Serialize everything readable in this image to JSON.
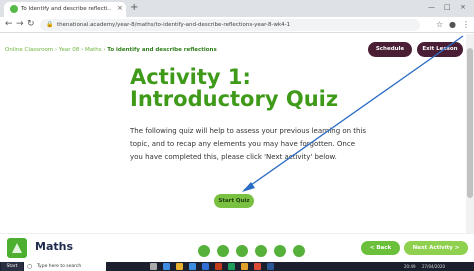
{
  "browser": {
    "tab_title": "To Identify and describe reflecti...",
    "tab_close": "×",
    "new_tab": "+",
    "window_controls": [
      "—",
      "□",
      "×"
    ],
    "url": "thenational.academy/year-8/maths/to-identify-and-describe-reflections-year-8-wk4-1",
    "nav_icons": [
      "back-icon",
      "forward-icon",
      "reload-icon"
    ],
    "toolbar_icons": [
      "star-icon",
      "profile-icon",
      "menu-icon"
    ]
  },
  "page": {
    "breadcrumb": {
      "prefix": "Online Classroom › Year 08 › Maths › ",
      "current": "To identify and describe reflections"
    },
    "schedule_label": "Schedule",
    "exit_label": "Exit Lesson",
    "activity_title": "Activity 1: Introductory Quiz",
    "intro_text": "The following quiz will help to assess your previous learning on this topic, and to recap any elements you may have forgotten. Once you have completed this, please click 'Next activity' below.",
    "start_label": "Start Quiz"
  },
  "footer": {
    "subject": "Maths",
    "progress_total": 6,
    "back_label": "< Back",
    "next_label": "Next Activity >"
  },
  "taskbar": {
    "start_label": "Start",
    "search_placeholder": "Type here to search",
    "tray_time": "20:49",
    "tray_date": "27/04/2020"
  },
  "colors": {
    "accent_green": "#3f9a1a",
    "button_purple": "#4a1f36",
    "arrow_blue": "#2b6cc4"
  }
}
